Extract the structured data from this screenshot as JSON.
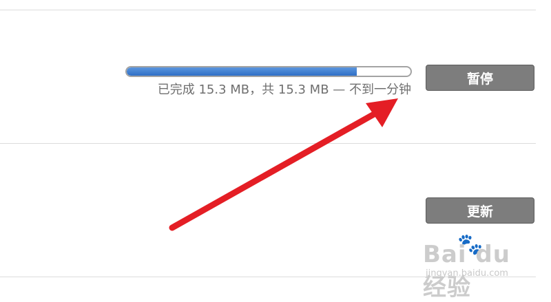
{
  "download": {
    "progress_fraction": 0.81,
    "status_text": "已完成 15.3 MB，共 15.3 MB — 不到一分钟",
    "pause_label": "暂停"
  },
  "update": {
    "update_label": "更新"
  },
  "annotation": {
    "arrow_color": "#e41e25"
  },
  "watermark": {
    "logo_text": "Bai du 经验",
    "sub_text": "jingyan.baidu.com"
  },
  "colors": {
    "progress_fill": "#3a7bd5",
    "button_bg": "#7d7d7d",
    "divider": "#dcdcdc"
  }
}
